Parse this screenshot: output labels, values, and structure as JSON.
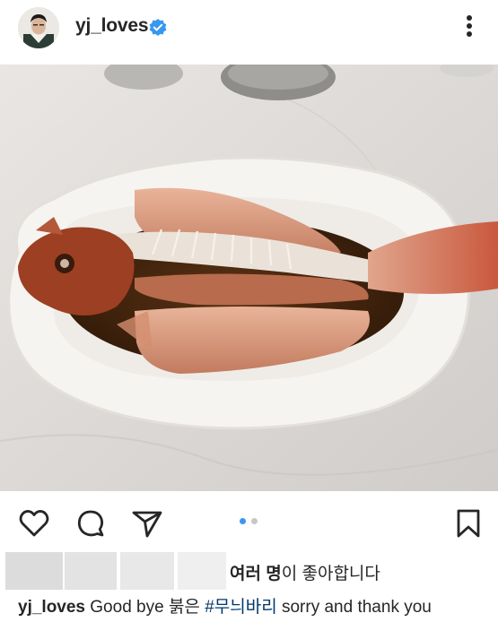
{
  "post": {
    "username": "yj_loves",
    "more_icon": "more-vertical-icon",
    "verified_icon": "verified-badge-icon",
    "carousel": {
      "count": 2,
      "active": 1
    }
  },
  "actions": {
    "like_icon": "heart-icon",
    "comment_icon": "comment-icon",
    "share_icon": "send-icon",
    "save_icon": "bookmark-icon"
  },
  "likes": {
    "text_bold": "여러 명",
    "text_rest": "이 좋아합니다"
  },
  "caption": {
    "user": "yj_loves",
    "text_before": "Good bye 붉은",
    "hashtag": "#무늬바리",
    "text_after": "sorry and thank you"
  },
  "colors": {
    "accent": "#3897f0",
    "hashtag": "#00376b",
    "verified": "#3897f0"
  }
}
